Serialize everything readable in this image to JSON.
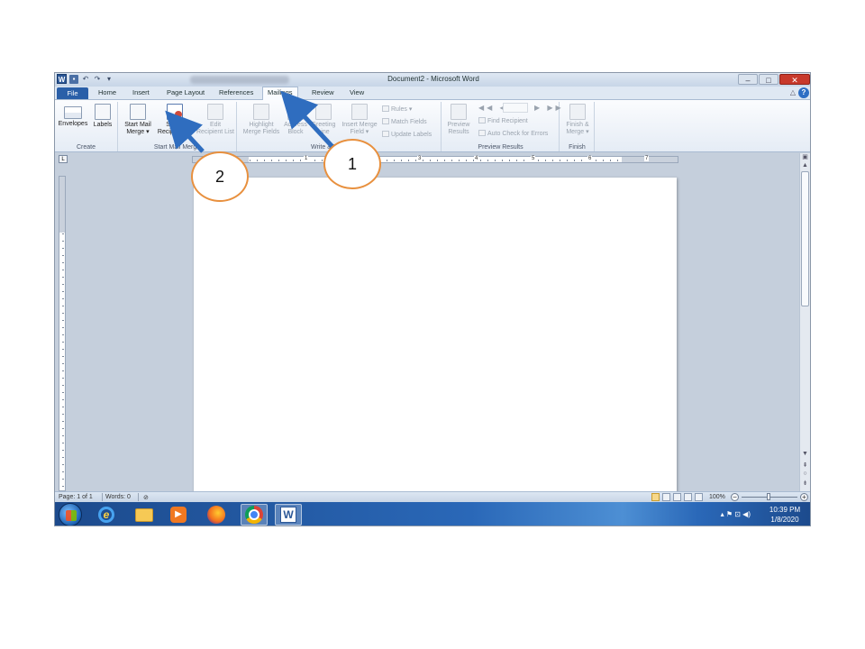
{
  "window": {
    "title": "Document2 - Microsoft Word",
    "minimize_icon": "minimize-icon",
    "maximize_icon": "maximize-icon",
    "close_icon": "close-icon"
  },
  "quick_access": {
    "undo": "↶",
    "redo": "↷",
    "customize": "▾"
  },
  "tabs": [
    {
      "label": "File"
    },
    {
      "label": "Home"
    },
    {
      "label": "Insert"
    },
    {
      "label": "Page Layout"
    },
    {
      "label": "References"
    },
    {
      "label": "Mailings"
    },
    {
      "label": "Review"
    },
    {
      "label": "View"
    }
  ],
  "active_tab": "Mailings",
  "ribbon": {
    "create": {
      "label": "Create",
      "envelopes": "Envelopes",
      "labels": "Labels"
    },
    "start_mail_merge": {
      "label": "Start Mail Merge",
      "start_line1": "Start Mail",
      "start_line2": "Merge ▾",
      "select_line1": "Select",
      "select_line2": "Recipients ▾",
      "edit_line1": "Edit",
      "edit_line2": "Recipient List"
    },
    "write_insert": {
      "label": "Write & Insert Fields",
      "highlight_line1": "Highlight",
      "highlight_line2": "Merge Fields",
      "address_line1": "Address",
      "address_line2": "Block",
      "greeting_line1": "Greeting",
      "greeting_line2": "Line",
      "insert_line1": "Insert Merge",
      "insert_line2": "Field ▾",
      "rules": "Rules ▾",
      "match_fields": "Match Fields",
      "update_labels": "Update Labels"
    },
    "preview_results": {
      "label": "Preview Results",
      "preview_line1": "Preview",
      "preview_line2": "Results",
      "nav": "◀◀ ◀",
      "nav_next": "▶ ▶▶",
      "find_recipient": "Find Recipient",
      "auto_check": "Auto Check for Errors"
    },
    "finish": {
      "label": "Finish",
      "finish_line1": "Finish &",
      "finish_line2": "Merge ▾"
    }
  },
  "ruler": {
    "marks": [
      "1",
      "2",
      "3",
      "4",
      "5",
      "6",
      "7"
    ]
  },
  "status_bar": {
    "page": "Page: 1 of 1",
    "words": "Words: 0",
    "zoom": "100%"
  },
  "taskbar": {
    "apps": [
      "internet-explorer",
      "file-explorer",
      "media-player",
      "firefox",
      "chrome",
      "word"
    ],
    "time": "10:39 PM",
    "date": "1/8/2020",
    "tray_icons": "▴  ⚑  ⊡  ◀)"
  },
  "annotations": [
    {
      "number": "1",
      "target": "Mailings tab"
    },
    {
      "number": "2",
      "target": "Select Recipients"
    }
  ]
}
